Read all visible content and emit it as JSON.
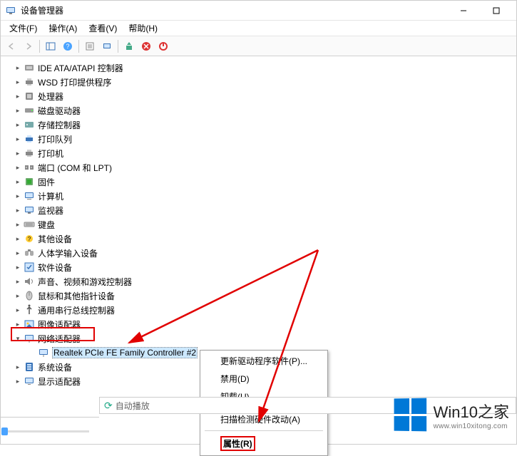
{
  "window": {
    "title": "设备管理器",
    "minimize": "—",
    "maximize": "☐"
  },
  "menu": {
    "file": "文件(F)",
    "action": "操作(A)",
    "view": "查看(V)",
    "help": "帮助(H)"
  },
  "tree": {
    "items": [
      {
        "label": "IDE ATA/ATAPI 控制器",
        "icon": "controller"
      },
      {
        "label": "WSD 打印提供程序",
        "icon": "printer"
      },
      {
        "label": "处理器",
        "icon": "cpu"
      },
      {
        "label": "磁盘驱动器",
        "icon": "disk"
      },
      {
        "label": "存储控制器",
        "icon": "storage"
      },
      {
        "label": "打印队列",
        "icon": "print-queue"
      },
      {
        "label": "打印机",
        "icon": "printer"
      },
      {
        "label": "端口 (COM 和 LPT)",
        "icon": "port"
      },
      {
        "label": "固件",
        "icon": "firmware"
      },
      {
        "label": "计算机",
        "icon": "computer"
      },
      {
        "label": "监视器",
        "icon": "monitor"
      },
      {
        "label": "键盘",
        "icon": "keyboard"
      },
      {
        "label": "其他设备",
        "icon": "other"
      },
      {
        "label": "人体学输入设备",
        "icon": "hid"
      },
      {
        "label": "软件设备",
        "icon": "software"
      },
      {
        "label": "声音、视频和游戏控制器",
        "icon": "sound"
      },
      {
        "label": "鼠标和其他指针设备",
        "icon": "mouse"
      },
      {
        "label": "通用串行总线控制器",
        "icon": "usb"
      },
      {
        "label": "图像适配器",
        "icon": "image"
      }
    ],
    "expanded": {
      "label": "网络适配器",
      "child": "Realtek PCIe FE Family Controller #2"
    },
    "after": [
      {
        "label": "系统设备",
        "icon": "system"
      },
      {
        "label": "显示适配器",
        "icon": "display"
      }
    ]
  },
  "context_menu": {
    "update_driver": "更新驱动程序软件(P)...",
    "disable": "禁用(D)",
    "uninstall": "卸载(U)",
    "scan_changes": "扫描检测硬件改动(A)",
    "properties": "属性(R)"
  },
  "autoplay": "自动播放",
  "watermark": {
    "main": "Win10之家",
    "sub": "www.win10xitong.com"
  }
}
